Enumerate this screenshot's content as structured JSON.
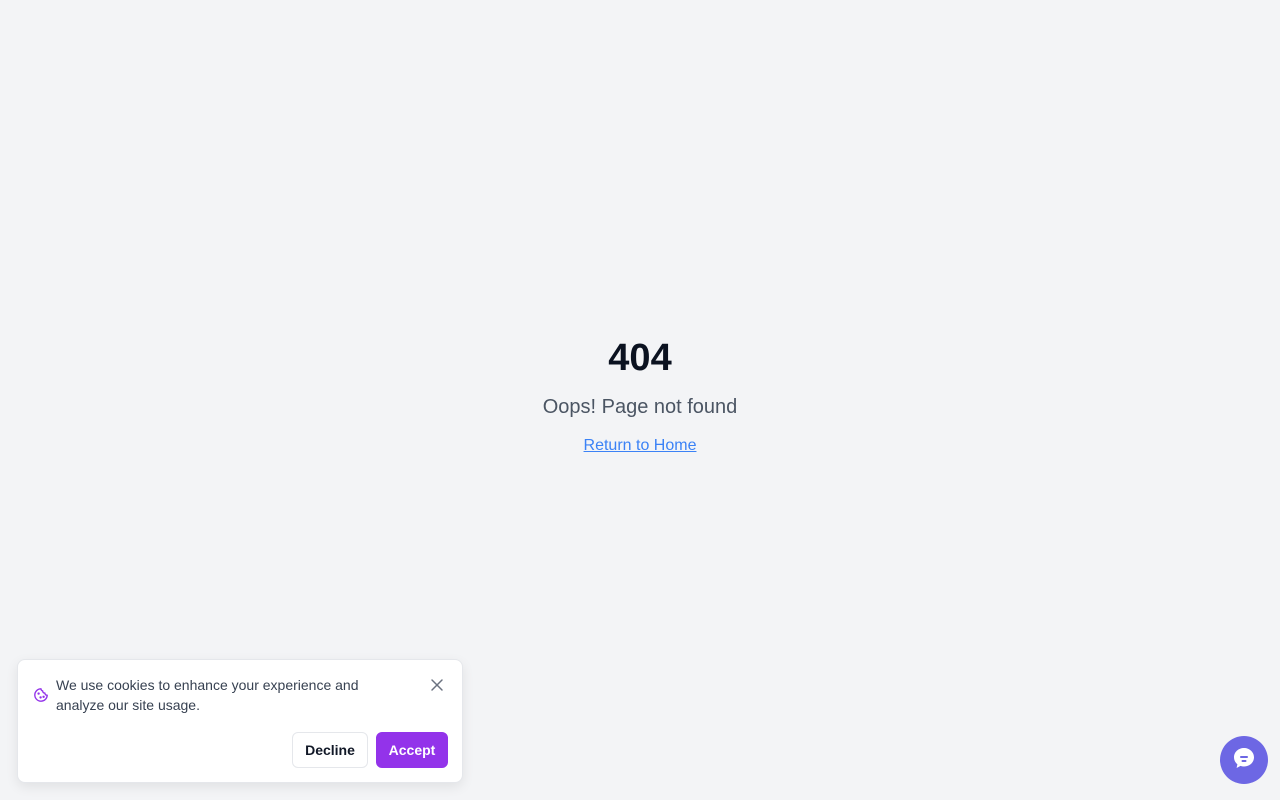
{
  "error": {
    "code": "404",
    "message": "Oops! Page not found",
    "home_link": "Return to Home"
  },
  "cookie_banner": {
    "text": "We use cookies to enhance your experience and analyze our site usage.",
    "decline_label": "Decline",
    "accept_label": "Accept",
    "icon": "cookie-icon",
    "close_icon": "close-icon"
  },
  "chat_widget": {
    "icon": "chat-icon"
  },
  "colors": {
    "background": "#f3f4f6",
    "link": "#3b82f6",
    "accent": "#9333ea",
    "chat": "#6d67e4"
  }
}
